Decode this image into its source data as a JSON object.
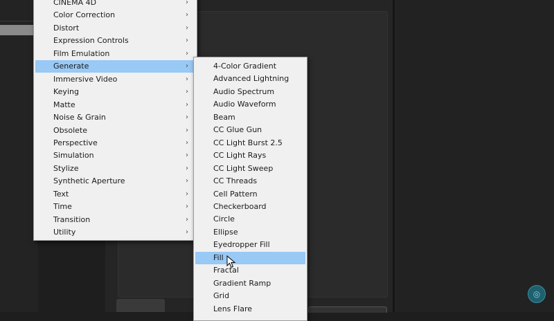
{
  "effects_menu": {
    "items": [
      {
        "label": "CINEMA 4D",
        "submenu": true,
        "highlighted": false
      },
      {
        "label": "Color Correction",
        "submenu": true,
        "highlighted": false
      },
      {
        "label": "Distort",
        "submenu": true,
        "highlighted": false
      },
      {
        "label": "Expression Controls",
        "submenu": true,
        "highlighted": false
      },
      {
        "label": "Film Emulation",
        "submenu": true,
        "highlighted": false
      },
      {
        "label": "Generate",
        "submenu": true,
        "highlighted": true
      },
      {
        "label": "Immersive Video",
        "submenu": true,
        "highlighted": false
      },
      {
        "label": "Keying",
        "submenu": true,
        "highlighted": false
      },
      {
        "label": "Matte",
        "submenu": true,
        "highlighted": false
      },
      {
        "label": "Noise & Grain",
        "submenu": true,
        "highlighted": false
      },
      {
        "label": "Obsolete",
        "submenu": true,
        "highlighted": false
      },
      {
        "label": "Perspective",
        "submenu": true,
        "highlighted": false
      },
      {
        "label": "Simulation",
        "submenu": true,
        "highlighted": false
      },
      {
        "label": "Stylize",
        "submenu": true,
        "highlighted": false
      },
      {
        "label": "Synthetic Aperture",
        "submenu": true,
        "highlighted": false
      },
      {
        "label": "Text",
        "submenu": true,
        "highlighted": false
      },
      {
        "label": "Time",
        "submenu": true,
        "highlighted": false
      },
      {
        "label": "Transition",
        "submenu": true,
        "highlighted": false
      },
      {
        "label": "Utility",
        "submenu": true,
        "highlighted": false
      }
    ]
  },
  "generate_menu": {
    "items": [
      {
        "label": "4-Color Gradient",
        "highlighted": false
      },
      {
        "label": "Advanced Lightning",
        "highlighted": false
      },
      {
        "label": "Audio Spectrum",
        "highlighted": false
      },
      {
        "label": "Audio Waveform",
        "highlighted": false
      },
      {
        "label": "Beam",
        "highlighted": false
      },
      {
        "label": "CC Glue Gun",
        "highlighted": false
      },
      {
        "label": "CC Light Burst 2.5",
        "highlighted": false
      },
      {
        "label": "CC Light Rays",
        "highlighted": false
      },
      {
        "label": "CC Light Sweep",
        "highlighted": false
      },
      {
        "label": "CC Threads",
        "highlighted": false
      },
      {
        "label": "Cell Pattern",
        "highlighted": false
      },
      {
        "label": "Checkerboard",
        "highlighted": false
      },
      {
        "label": "Circle",
        "highlighted": false
      },
      {
        "label": "Ellipse",
        "highlighted": false
      },
      {
        "label": "Eyedropper Fill",
        "highlighted": false
      },
      {
        "label": "Fill",
        "highlighted": true
      },
      {
        "label": "Fractal",
        "highlighted": false
      },
      {
        "label": "Gradient Ramp",
        "highlighted": false
      },
      {
        "label": "Grid",
        "highlighted": false
      },
      {
        "label": "Lens Flare",
        "highlighted": false
      }
    ]
  },
  "colors": {
    "menu_bg": "#f0f0f0",
    "highlight": "#99c9f5",
    "app_bg": "#1e1e1e"
  },
  "icons": {
    "submenu_arrow": "chevron-right-icon",
    "cursor": "mouse-pointer-icon",
    "help": "help-icon"
  }
}
